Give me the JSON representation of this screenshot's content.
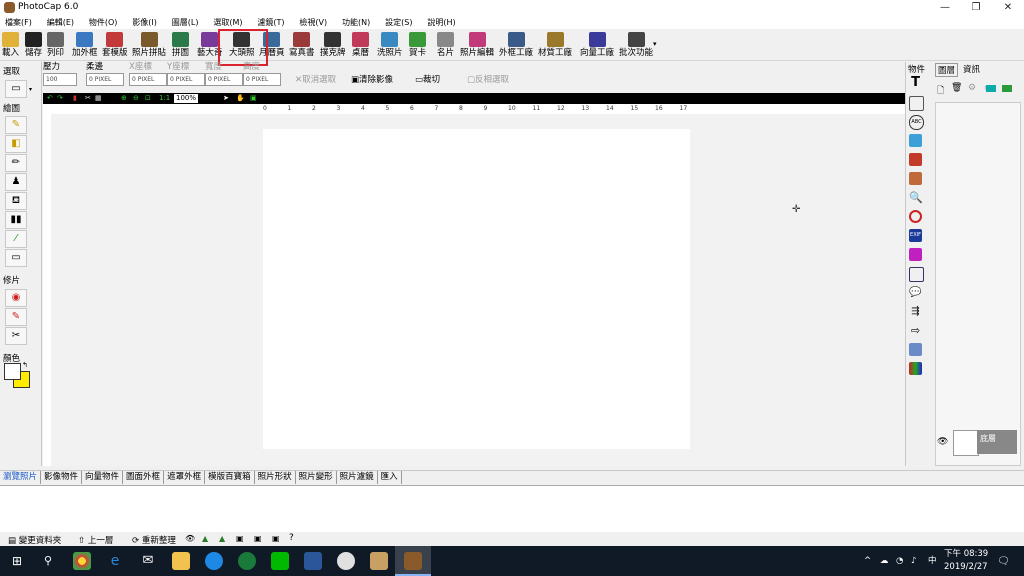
{
  "window": {
    "title": "PhotoCap 6.0",
    "min": "—",
    "max": "❐",
    "close": "✕"
  },
  "menu": [
    "檔案(F)",
    "編輯(E)",
    "物件(O)",
    "影像(I)",
    "圖層(L)",
    "選取(M)",
    "濾鏡(T)",
    "檢視(V)",
    "功能(N)",
    "設定(S)",
    "說明(H)"
  ],
  "toolbar": [
    {
      "label": "載入",
      "icon": "open-folder-icon",
      "color": "#e0b23a"
    },
    {
      "label": "儲存",
      "icon": "save-icon",
      "color": "#222"
    },
    {
      "label": "列印",
      "icon": "printer-icon",
      "color": "#666"
    },
    {
      "label": "加外框",
      "icon": "frame-icon",
      "color": "#3a78c2"
    },
    {
      "label": "套模版",
      "icon": "template-icon",
      "color": "#c23a3a"
    },
    {
      "label": "照片拼貼",
      "icon": "collage-icon",
      "color": "#7a5a2a"
    },
    {
      "label": "拼圖",
      "icon": "puzzle-icon",
      "color": "#2a7a4a"
    },
    {
      "label": "藝大奇",
      "icon": "art-icon",
      "color": "#7a3a9a"
    },
    {
      "label": "大頭照",
      "icon": "id-photo-grid-icon",
      "color": "#333"
    },
    {
      "label": "月曆頁",
      "icon": "calendar-page-icon",
      "color": "#3a6a9a"
    },
    {
      "label": "寫真書",
      "icon": "photobook-icon",
      "color": "#9a3a3a"
    },
    {
      "label": "撲克牌",
      "icon": "poker-card-icon",
      "color": "#333"
    },
    {
      "label": "桌曆",
      "icon": "desk-calendar-icon",
      "color": "#c23a5a"
    },
    {
      "label": "洗照片",
      "icon": "print-photo-icon",
      "color": "#3a8ac2"
    },
    {
      "label": "賀卡",
      "icon": "greeting-card-icon",
      "color": "#3a9a3a"
    },
    {
      "label": "名片",
      "icon": "business-card-icon",
      "color": "#888"
    },
    {
      "label": "照片編輯",
      "icon": "photo-edit-icon",
      "color": "#c23a7a"
    },
    {
      "label": "外框工廠",
      "icon": "frame-factory-icon",
      "color": "#3a5a8a"
    },
    {
      "label": "材質工廠",
      "icon": "texture-factory-icon",
      "color": "#9a7a2a"
    },
    {
      "label": "向量工廠",
      "icon": "vector-factory-icon",
      "color": "#3a3a9a"
    },
    {
      "label": "批次功能",
      "icon": "batch-icon",
      "color": "#444"
    }
  ],
  "options": {
    "pressure_label": "壓力",
    "pressure_value": "100",
    "feather_label": "柔邊",
    "feather_value": "0 PIXEL",
    "x_label": "X座標",
    "x_value": "0 PIXEL",
    "y_label": "Y座標",
    "y_value": "0 PIXEL",
    "w_label": "寬度",
    "w_value": "0 PIXEL",
    "h_label": "高度",
    "h_value": "0 PIXEL",
    "cancel_select": "取消選取",
    "clear_image": "清除影像",
    "crop": "裁切",
    "invert_select": "反相選取"
  },
  "left": {
    "select": "選取",
    "draw": "繪圖",
    "retouch": "修片",
    "color": "顏色"
  },
  "zoom": "100%",
  "ruler_marks": [
    "0",
    "1",
    "2",
    "3",
    "4",
    "5",
    "6",
    "7",
    "8",
    "9",
    "10",
    "11",
    "12",
    "13",
    "14",
    "15",
    "16",
    "17"
  ],
  "right_tabs": {
    "objects": "物件",
    "layers": "圖層",
    "info": "資訊"
  },
  "layer": {
    "name": "底層"
  },
  "bottom_tabs": [
    "瀏覽照片",
    "影像物件",
    "向量物件",
    "圖面外框",
    "遮罩外框",
    "模版百寶箱",
    "照片形狀",
    "照片變形",
    "照片濾鏡",
    "匯入"
  ],
  "status": {
    "change_folder": "變更資料夾",
    "up": "上一層",
    "refresh": "重新整理",
    "help": "?"
  },
  "taskbar": {
    "time": "下午 08:39",
    "date": "2019/2/27",
    "ime": "中"
  },
  "colors": {
    "highlight": "#d9232e",
    "fg_color": "#ffffff",
    "bg_color": "#ffec00"
  }
}
